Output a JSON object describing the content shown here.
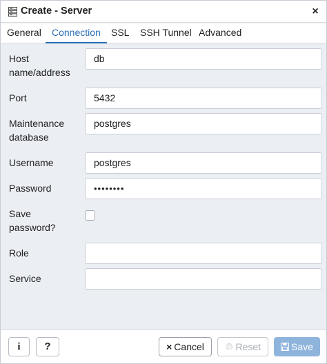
{
  "dialog": {
    "title": "Create - Server",
    "close_glyph": "×",
    "title_icon": "server-icon"
  },
  "tabs": [
    {
      "label": "General",
      "active": false
    },
    {
      "label": "Connection",
      "active": true
    },
    {
      "label": "SSL",
      "active": false
    },
    {
      "label": "SSH Tunnel",
      "active": false
    },
    {
      "label": "Advanced",
      "active": false
    }
  ],
  "form": {
    "host": {
      "label": "Host name/address",
      "value": "db"
    },
    "port": {
      "label": "Port",
      "value": "5432"
    },
    "maintenance_db": {
      "label": "Maintenance database",
      "value": "postgres"
    },
    "username": {
      "label": "Username",
      "value": "postgres"
    },
    "password": {
      "label": "Password",
      "value": "••••••••"
    },
    "save_password": {
      "label": "Save password?",
      "checked": false
    },
    "role": {
      "label": "Role",
      "value": ""
    },
    "service": {
      "label": "Service",
      "value": ""
    }
  },
  "footer": {
    "info_glyph": "i",
    "help_glyph": "?",
    "cancel": {
      "label": "Cancel",
      "icon": "×"
    },
    "reset": {
      "label": "Reset",
      "icon": "♲"
    },
    "save": {
      "label": "Save",
      "icon": "🖫"
    }
  },
  "colors": {
    "accent": "#2c6fb5",
    "save_button": "#8fb4dc",
    "body_background": "#ebeef3"
  }
}
